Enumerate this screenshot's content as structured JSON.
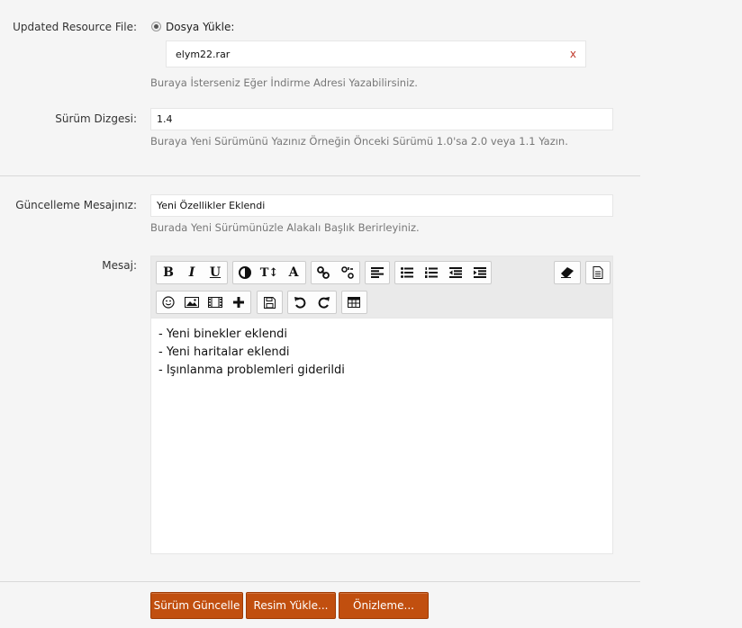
{
  "resource_file": {
    "label": "Updated Resource File:",
    "radio_label": "Dosya Yükle:",
    "file_name": "elym22.rar",
    "clear": "x",
    "hint": "Buraya İsterseniz Eğer İndirme Adresi Yazabilirsiniz."
  },
  "version": {
    "label": "Sürüm Dizgesi:",
    "value": "1.4",
    "hint": "Buraya Yeni Sürümünü Yazınız Örneğin Önceki Sürümü 1.0'sa 2.0 veya 1.1 Yazın."
  },
  "update_message": {
    "label": "Güncelleme Mesajınız:",
    "value": "Yeni Özellikler Eklendi",
    "hint": "Burada Yeni Sürümünüzle Alakalı Başlık Berirleyiniz."
  },
  "message": {
    "label": "Mesaj:",
    "toolbar": {
      "bold": "B",
      "italic": "I",
      "underline": "U",
      "font_size": "T↕",
      "font": "A"
    },
    "lines": [
      "- Yeni binekler eklendi",
      "- Yeni haritalar eklendi",
      "- Işınlanma problemleri giderildi"
    ]
  },
  "buttons": {
    "save": "Sürüm Güncelle",
    "upload_image": "Resim Yükle...",
    "preview": "Önizleme..."
  },
  "colors": {
    "button_bg": "#c14f0f",
    "background": "#f5f5f5"
  }
}
